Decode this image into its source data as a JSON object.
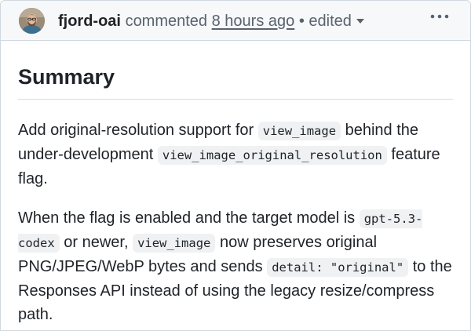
{
  "comment": {
    "author": "fjord-oai",
    "action": "commented",
    "time": "8 hours ago",
    "separator": "•",
    "edited": "edited",
    "more_icon": "kebab-horizontal-icon",
    "avatar_icon": "user-avatar"
  },
  "body": {
    "heading": "Summary",
    "p1": {
      "t1": "Add original-resolution support for ",
      "c1": "view_image",
      "t2": " behind the under-development ",
      "c2": "view_image_original_resolution",
      "t3": " feature flag."
    },
    "p2": {
      "t1": "When the flag is enabled and the target model is ",
      "c1": "gpt-5.3-codex",
      "t2": " or newer, ",
      "c2": "view_image",
      "t3": " now preserves original PNG/JPEG/WebP bytes and sends ",
      "c3": "detail: \"original\"",
      "t4": " to the Responses API instead of using the legacy resize/compress path."
    }
  },
  "colors": {
    "text": "#1f2328",
    "muted": "#59636e",
    "header_bg": "#f6f8fa",
    "border": "#d0d7de",
    "code_bg": "#eff1f3"
  }
}
